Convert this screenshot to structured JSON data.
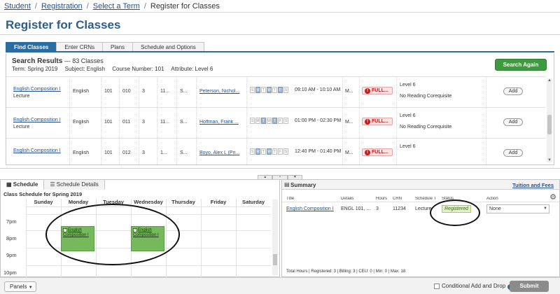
{
  "breadcrumb": [
    "Student",
    "Registration",
    "Select a Term",
    "Register for Classes"
  ],
  "page_title": "Register for Classes",
  "tabs": [
    "Find Classes",
    "Enter CRNs",
    "Plans",
    "Schedule and Options"
  ],
  "search": {
    "heading": "Search Results",
    "count": "— 83 Classes",
    "term": "Term: Spring 2019",
    "subject": "Subject: English",
    "course_number": "Course Number: 101",
    "attribute": "Attribute: Level 6",
    "button": "Search Again"
  },
  "results": [
    {
      "title": "English Composition I",
      "type": "Lecture",
      "subject": "English",
      "course": "101",
      "section": "010",
      "hours": "3",
      "crn": "11...",
      "term": "S...",
      "instructor": "Peterson, Nichol...",
      "days": [
        "S",
        "M",
        "T",
        "W",
        "T",
        "F",
        "S"
      ],
      "days_on": [
        1,
        3,
        5
      ],
      "time": "09:10 AM - 10:10 AM",
      "campus": "M...",
      "status": "FULL...",
      "attr1": "Level 6",
      "attr2": "No Reading Corequisite",
      "action": "Add"
    },
    {
      "title": "English Composition I",
      "type": "Lecture",
      "subject": "English",
      "course": "101",
      "section": "011",
      "hours": "3",
      "crn": "11...",
      "term": "S...",
      "instructor": "Hoffman, Frank ...",
      "days": [
        "S",
        "M",
        "T",
        "W",
        "T",
        "F",
        "S"
      ],
      "days_on": [
        2,
        4
      ],
      "time": "01:00 PM - 02:30 PM",
      "campus": "M...",
      "status": "FULL...",
      "attr1": "Level 6",
      "attr2": "No Reading Corequisite",
      "action": "Add"
    },
    {
      "title": "English Composition I",
      "type": "",
      "subject": "English",
      "course": "101",
      "section": "012",
      "hours": "3",
      "crn": "1...",
      "term": "S...",
      "instructor": "Boyo, Alex L (Pri...",
      "days": [
        "S",
        "M",
        "T",
        "W",
        "T",
        "F",
        "S"
      ],
      "days_on": [
        1,
        3
      ],
      "time": "12:40 PM - 01:40 PM",
      "campus": "M...",
      "status": "FULL...",
      "attr1": "Level 6",
      "attr2": "",
      "action": "Add"
    }
  ],
  "schedule": {
    "tab_schedule": "Schedule",
    "tab_details": "Schedule Details",
    "caption": "Class Schedule for Spring 2019",
    "days": [
      "Sunday",
      "Monday",
      "Tuesday",
      "Wednesday",
      "Thursday",
      "Friday",
      "Saturday"
    ],
    "times": [
      "7pm",
      "8pm",
      "9pm",
      "10pm"
    ],
    "events": [
      {
        "day": "Monday",
        "label": "English Composition I"
      },
      {
        "day": "Wednesday",
        "label": "English Composition I"
      }
    ]
  },
  "summary": {
    "title": "Summary",
    "link": "Tuition and Fees",
    "columns": [
      "Title",
      "Details",
      "Hours",
      "CRN",
      "Schedule T",
      "Status",
      "Action"
    ],
    "row": {
      "title": "English Composition I",
      "details": "ENGL 101, ...",
      "hours": "3",
      "crn": "11234",
      "schedule_type": "Lecture",
      "status": "Registered",
      "action": "None"
    },
    "totals": "Total Hours | Registered: 3 | Billing: 3 | CEU: 0 | Min: 0 | Max: 18"
  },
  "footer": {
    "panels": "Panels",
    "conditional": "Conditional Add and Drop",
    "submit": "Submit"
  },
  "colors": {
    "brand_blue": "#2b6ca3",
    "success_green": "#3e9a3e",
    "event_green": "#76b95c",
    "full_red": "#c41b1b"
  }
}
